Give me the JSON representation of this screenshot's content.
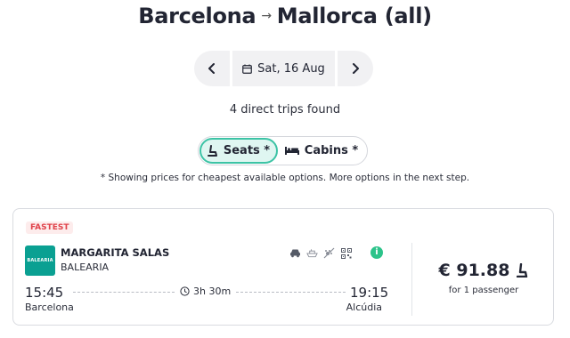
{
  "route": {
    "origin": "Barcelona",
    "arrow": "→",
    "destination": "Mallorca (all)"
  },
  "date_nav": {
    "date_label": "Sat, 16 Aug"
  },
  "results": {
    "summary": "4 direct trips found"
  },
  "toggle": {
    "seats_label": "Seats *",
    "cabins_label": "Cabins *",
    "selected": "seats"
  },
  "note": "* Showing prices for cheapest available options. More options in the next step.",
  "trip": {
    "badge": "FASTEST",
    "logo_text": "BALEARIA",
    "ship_name": "MARGARITA SALAS",
    "operator": "BALEARIA",
    "amenities": [
      "car-icon",
      "ship-icon",
      "no-pets-icon",
      "qr-code-icon"
    ],
    "departure_time": "15:45",
    "departure_port": "Barcelona",
    "duration": "3h 30m",
    "arrival_time": "19:15",
    "arrival_port": "Alcúdia",
    "price": "€ 91.88",
    "passengers": "for 1 passenger"
  },
  "colors": {
    "accent": "#3cc3a5",
    "accent_bg": "#dff6f1",
    "badge_text": "#e0434b",
    "logo_bg": "#0aa092",
    "info": "#2cc38a"
  }
}
